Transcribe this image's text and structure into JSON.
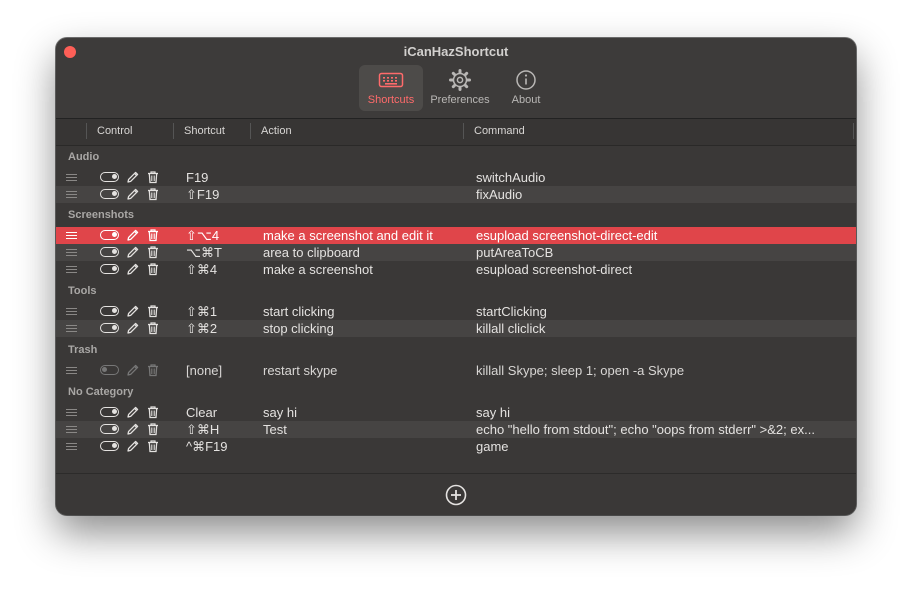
{
  "window": {
    "title": "iCanHazShortcut"
  },
  "tabs": [
    {
      "label": "Shortcuts",
      "icon": "keyboard-icon",
      "active": true
    },
    {
      "label": "Preferences",
      "icon": "gear-icon",
      "active": false
    },
    {
      "label": "About",
      "icon": "info-icon",
      "active": false
    }
  ],
  "columns": {
    "control": "Control",
    "shortcut": "Shortcut",
    "action": "Action",
    "command": "Command"
  },
  "categories": [
    {
      "name": "Audio",
      "rows": [
        {
          "shortcut": "F19",
          "action": "",
          "command": "switchAudio"
        },
        {
          "shortcut": "⇧F19",
          "action": "",
          "command": "fixAudio"
        }
      ]
    },
    {
      "name": "Screenshots",
      "rows": [
        {
          "shortcut": "⇧⌥4",
          "action": "make a screenshot and edit it",
          "command": "esupload screenshot-direct-edit",
          "selected": true
        },
        {
          "shortcut": "⌥⌘T",
          "action": "area to clipboard",
          "command": "putAreaToCB"
        },
        {
          "shortcut": "⇧⌘4",
          "action": "make a screenshot",
          "command": "esupload screenshot-direct"
        }
      ]
    },
    {
      "name": "Tools",
      "rows": [
        {
          "shortcut": "⇧⌘1",
          "action": "start clicking",
          "command": "startClicking"
        },
        {
          "shortcut": "⇧⌘2",
          "action": "stop clicking",
          "command": "killall cliclick"
        }
      ]
    },
    {
      "name": "Trash",
      "rows": [
        {
          "shortcut": "[none]",
          "action": "restart skype",
          "command": "killall Skype; sleep 1; open -a Skype",
          "disabled": true
        }
      ]
    },
    {
      "name": "No Category",
      "rows": [
        {
          "shortcut": "Clear",
          "action": "say hi",
          "command": "say hi"
        },
        {
          "shortcut": "⇧⌘H",
          "action": "Test",
          "command": "echo \"hello from stdout\"; echo \"oops from stderr\" >&2; ex..."
        },
        {
          "shortcut": "^⌘F19",
          "action": "",
          "command": "game"
        }
      ]
    }
  ],
  "colors": {
    "accent": "#e0454a",
    "close": "#fe5f57",
    "background": "#3a3837"
  }
}
